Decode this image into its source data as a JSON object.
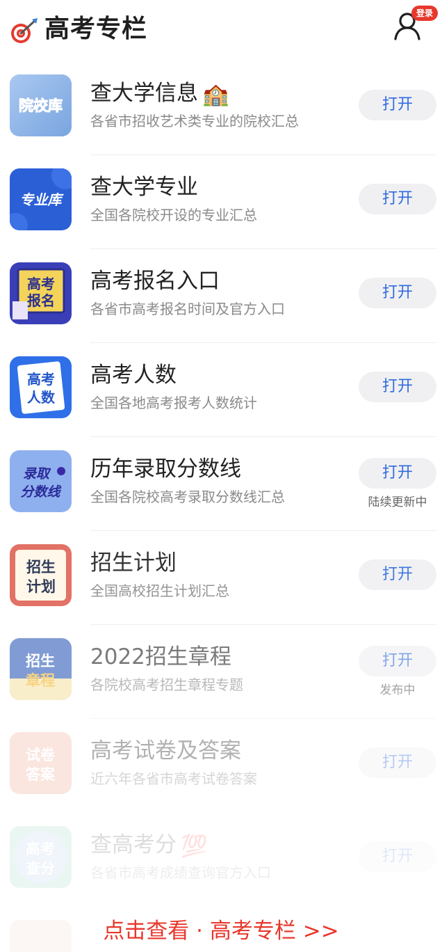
{
  "header": {
    "title": "高考专栏",
    "login_badge": "登录",
    "logo_icon": "dart-target-icon",
    "user_icon": "user-icon"
  },
  "colors": {
    "accent": "#2f6bde",
    "badge": "#e8372c",
    "footer_link": "#e8372c",
    "button_bg": "#f0f0f2"
  },
  "items": [
    {
      "title": "查大学信息",
      "emoji": "🏫",
      "desc": "各省市招收艺术类专业的院校汇总",
      "button": "打开",
      "note": "",
      "thumb_text": [
        "院校库"
      ]
    },
    {
      "title": "查大学专业",
      "emoji": "",
      "desc": "全国各院校开设的专业汇总",
      "button": "打开",
      "note": "",
      "thumb_text": [
        "专业库"
      ]
    },
    {
      "title": "高考报名入口",
      "emoji": "",
      "desc": "各省市高考报名时间及官方入口",
      "button": "打开",
      "note": "",
      "thumb_text": [
        "高考",
        "报名"
      ]
    },
    {
      "title": "高考人数",
      "emoji": "",
      "desc": "全国各地高考报考人数统计",
      "button": "打开",
      "note": "",
      "thumb_text": [
        "高考",
        "人数"
      ]
    },
    {
      "title": "历年录取分数线",
      "emoji": "",
      "desc": "全国各院校高考录取分数线汇总",
      "button": "打开",
      "note": "陆续更新中",
      "thumb_text": [
        "录取",
        "分数线"
      ]
    },
    {
      "title": "招生计划",
      "emoji": "",
      "desc": "全国高校招生计划汇总",
      "button": "打开",
      "note": "",
      "thumb_text": [
        "招生",
        "计划"
      ]
    },
    {
      "title": "2022招生章程",
      "emoji": "",
      "desc": "各院校高考招生章程专题",
      "button": "打开",
      "note": "发布中",
      "thumb_text": [
        "招生",
        "章程"
      ]
    },
    {
      "title": "高考试卷及答案",
      "emoji": "",
      "desc": "近六年各省市高考试卷答案",
      "button": "打开",
      "note": "",
      "thumb_text": [
        "试卷",
        "答案"
      ]
    },
    {
      "title": "查高考分",
      "emoji": "💯",
      "desc": "各省市高考成绩查询官方入口",
      "button": "打开",
      "note": "",
      "thumb_text": [
        "高考",
        "查分"
      ]
    }
  ],
  "footer": {
    "link": "点击查看 · 高考专栏 >>"
  }
}
